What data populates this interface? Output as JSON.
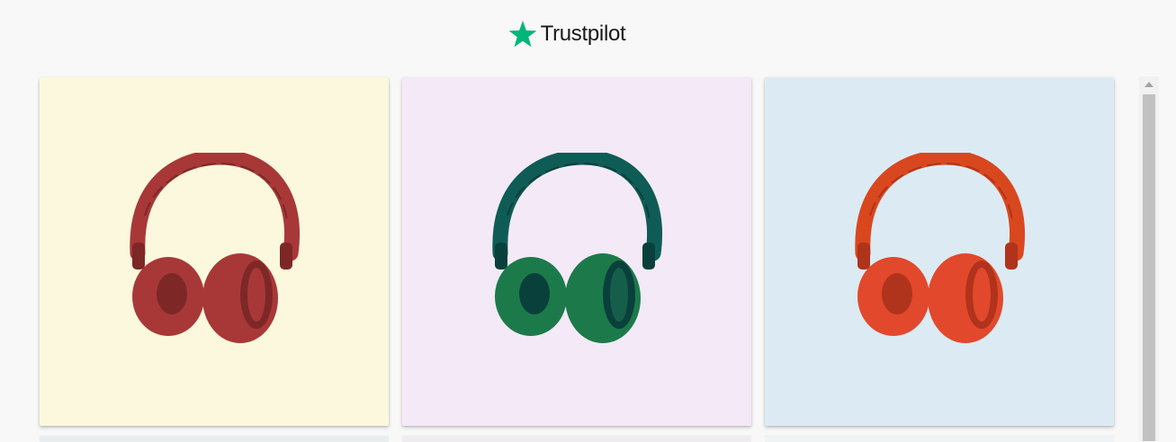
{
  "header": {
    "brand": "Trustpilot",
    "star_icon": "star-icon",
    "star_color": "#00b67a"
  },
  "products": [
    {
      "name": "headphones-red",
      "background": "#fbf8dd",
      "headphone_color": "#a83838",
      "headphone_dark": "#7e2727",
      "icon": "headphones-icon"
    },
    {
      "name": "headphones-teal",
      "background": "#f4e9f7",
      "headphone_color": "#0f5c56",
      "headphone_green": "#1c7a4a",
      "headphone_dark": "#0a403c",
      "icon": "headphones-icon"
    },
    {
      "name": "headphones-orange",
      "background": "#dcebf3",
      "headphone_color": "#e2482c",
      "headphone_dark": "#b0331c",
      "icon": "headphones-icon"
    }
  ],
  "scrollbar": {
    "track_color": "#f1f1f1",
    "thumb_color": "#c1c1c1"
  }
}
